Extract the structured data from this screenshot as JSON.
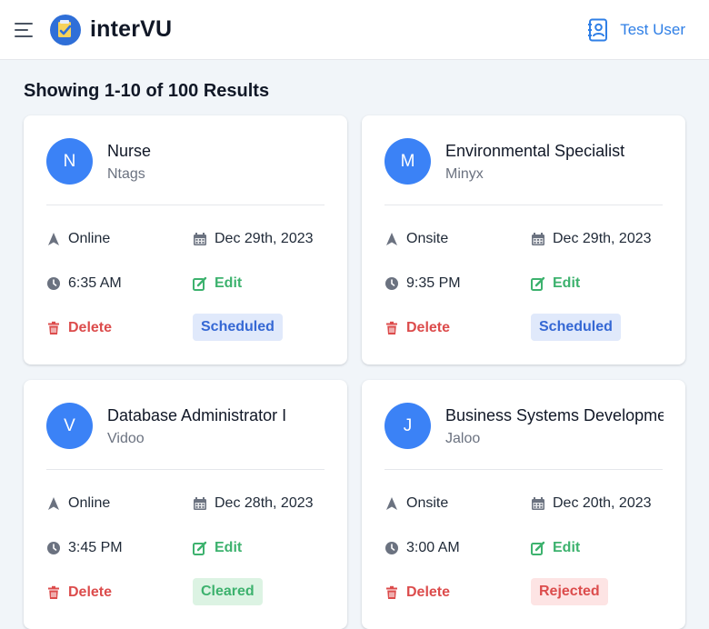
{
  "header": {
    "brand": "interVU",
    "user_name": "Test User",
    "icons": {
      "menu": "hamburger-menu-icon",
      "logo": "intervu-logo-icon",
      "user": "user-contact-book-icon"
    }
  },
  "summary": "Showing 1-10 of 100 Results",
  "actions": {
    "edit": "Edit",
    "delete": "Delete"
  },
  "colors": {
    "accent": "#3b82f6",
    "edit": "#3db26e",
    "delete": "#dc4c4c",
    "scheduled": "#3568d4"
  },
  "cards": [
    {
      "initial": "N",
      "title": "Nurse",
      "company": "Ntags",
      "mode": "Online",
      "date": "Dec 29th, 2023",
      "time": "6:35 AM",
      "status": "Scheduled"
    },
    {
      "initial": "M",
      "title": "Environmental Specialist",
      "company": "Minyx",
      "mode": "Onsite",
      "date": "Dec 29th, 2023",
      "time": "9:35 PM",
      "status": "Scheduled"
    },
    {
      "initial": "V",
      "title": "Database Administrator I",
      "company": "Vidoo",
      "mode": "Online",
      "date": "Dec 28th, 2023",
      "time": "3:45 PM",
      "status": "Cleared"
    },
    {
      "initial": "J",
      "title": "Business Systems Development Analyst",
      "company": "Jaloo",
      "mode": "Onsite",
      "date": "Dec 20th, 2023",
      "time": "3:00 AM",
      "status": "Rejected"
    }
  ]
}
